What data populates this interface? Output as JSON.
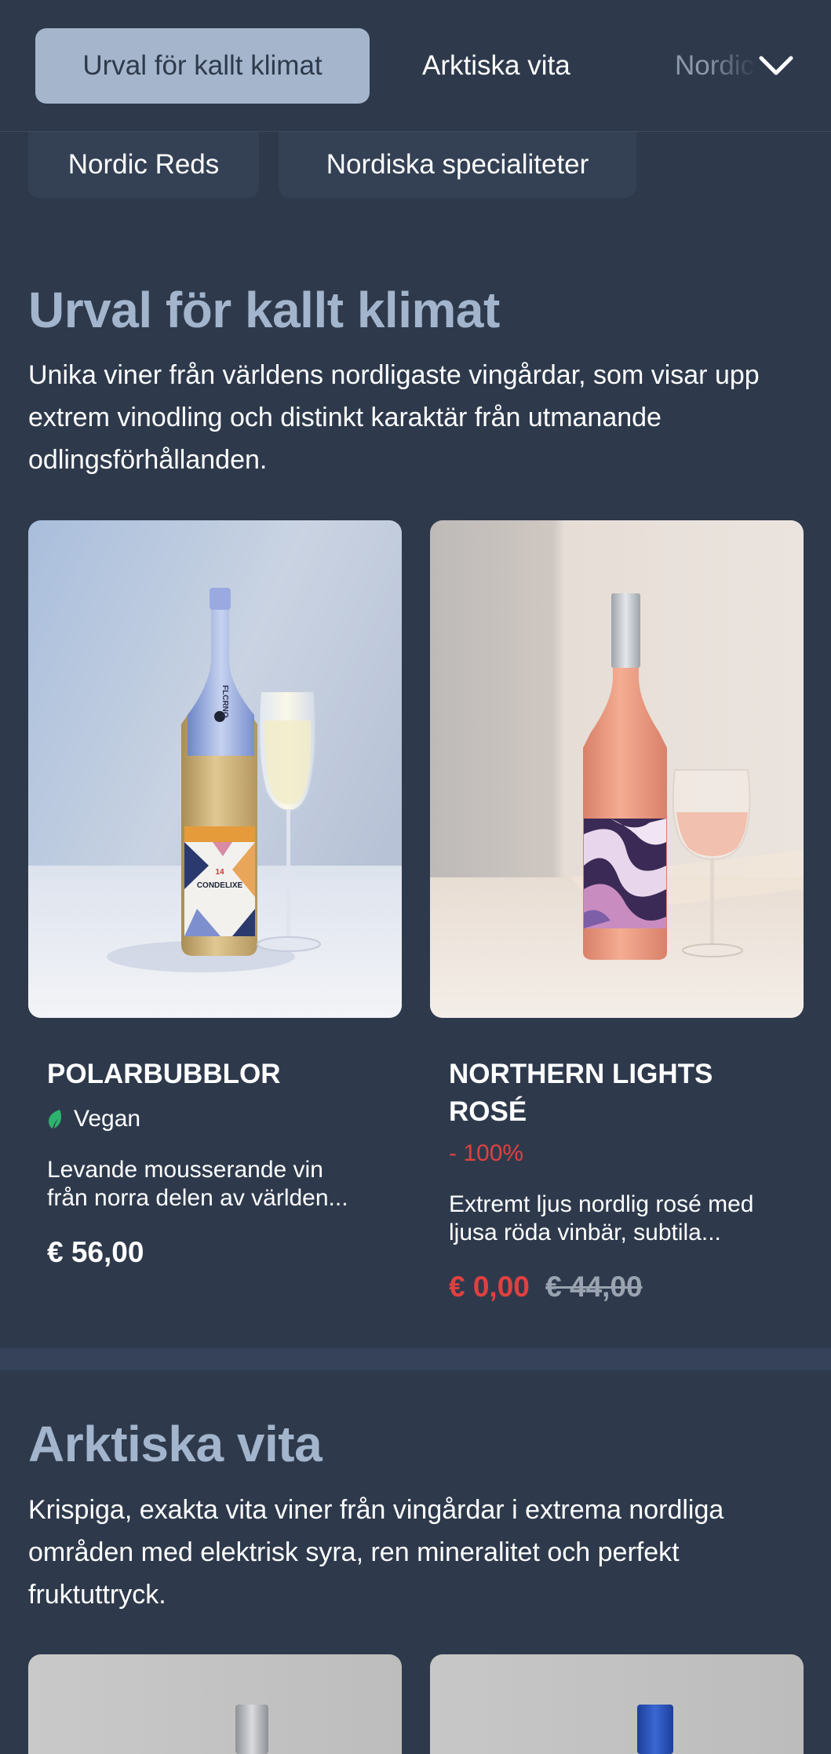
{
  "tabs": {
    "active": "Urval för kallt klimat",
    "second": "Arktiska vita",
    "third_clipped": "Nordic Reds",
    "row2": [
      "Nordic Reds",
      "Nordiska specialiteter"
    ]
  },
  "sections": [
    {
      "title": "Urval för kallt klimat",
      "description": "Unika viner från världens nordligaste vingårdar, som visar upp extrem vinodling och distinkt karaktär från utmanande odlingsförhållanden.",
      "products": [
        {
          "name": "POLARBUBBLOR",
          "tag": "Vegan",
          "description_line1": "Levande mousserande vin",
          "description_line2": "från norra delen av världen...",
          "price": "€ 56,00",
          "bottle_label_top": "FLCRNO",
          "bottle_label_brand": "CONDELIXE",
          "bottle_label_year": "14"
        },
        {
          "name_line1": "NORTHERN LIGHTS",
          "name_line2": "ROSÉ",
          "discount": "- 100%",
          "description_line1": "Extremt ljus nordlig rosé med",
          "description_line2": "ljusa röda vinbär, subtila...",
          "price_sale": "€ 0,00",
          "price_old": "€ 44,00"
        }
      ]
    },
    {
      "title": "Arktiska vita",
      "description": "Krispiga, exakta vita viner från vingårdar i extrema nordliga områden med elektrisk syra, ren mineralitet och perfekt fruktuttryck."
    }
  ],
  "colors": {
    "background": "#2e3a4c",
    "active_tab": "#a5b6cc",
    "heading": "#a3b5cc",
    "sale_red": "#e0413f",
    "vegan_green": "#2db36f"
  },
  "icons": {
    "dropdown": "chevron-down-icon",
    "vegan": "leaf-icon"
  }
}
